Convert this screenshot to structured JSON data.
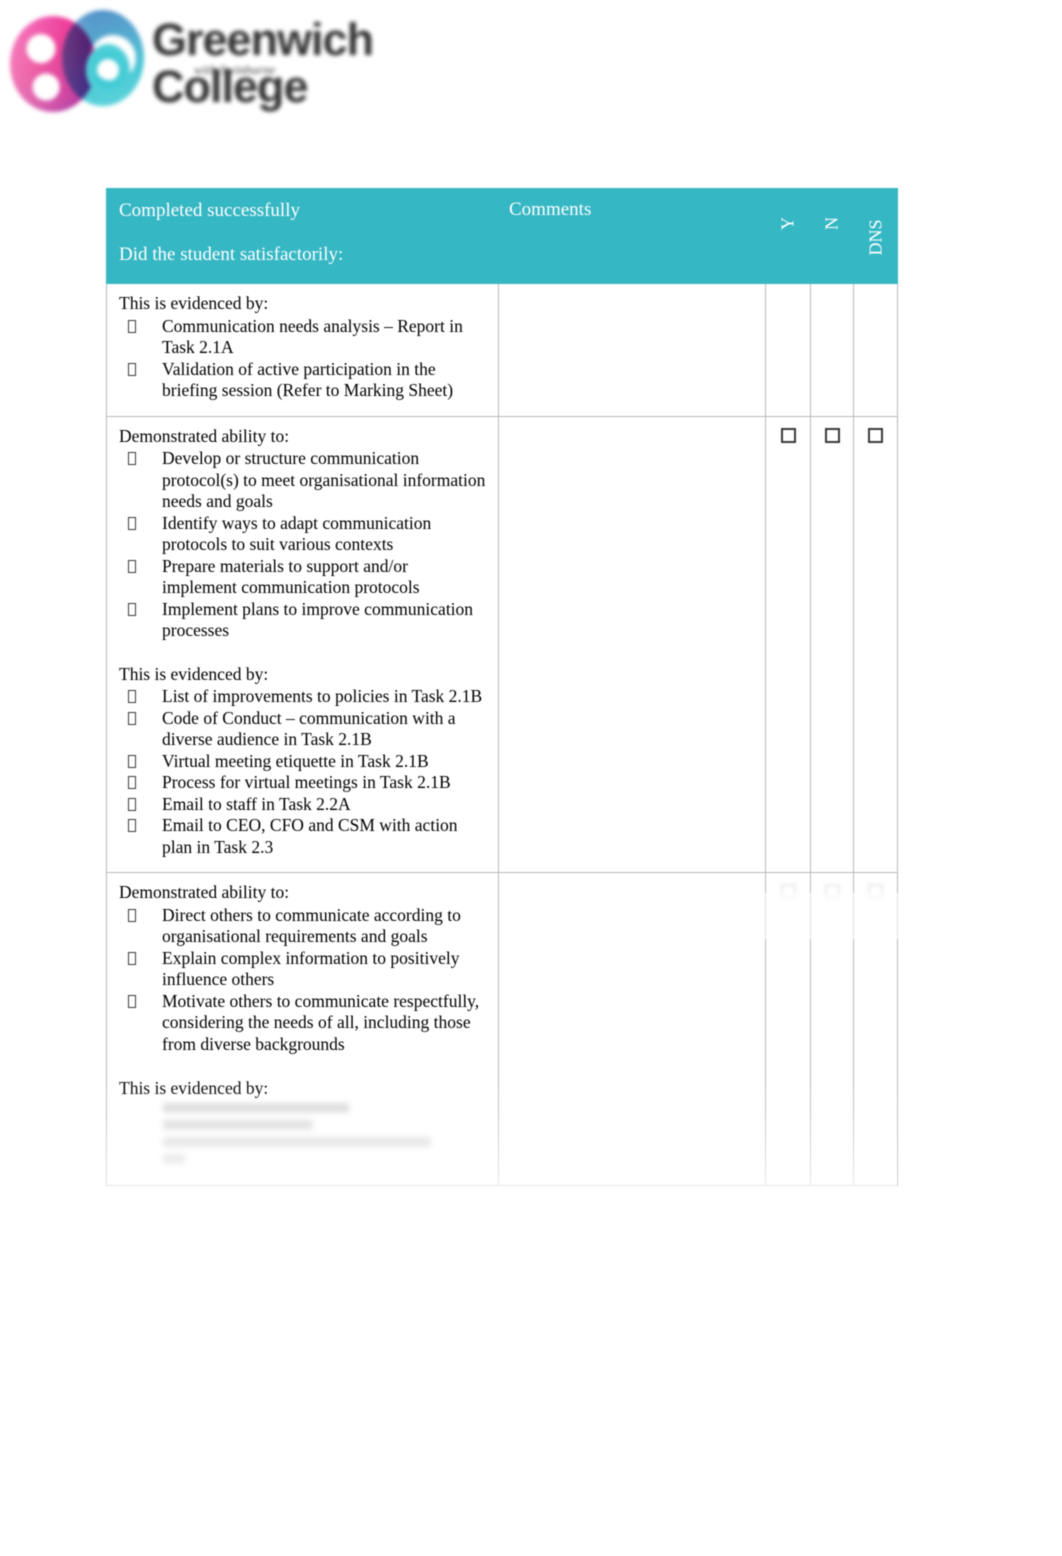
{
  "brand": {
    "logo_word_line1": "Greenwich",
    "logo_word_line2": "College",
    "logo_tagline": "with Swinburne",
    "accent_teal": "#36b7c4",
    "accent_pink": "#ef1d94",
    "link_teal": "#5fcede"
  },
  "table": {
    "header": {
      "col1_line1": "Completed successfully",
      "col1_line2": "Did the student satisfactorily:",
      "col2": "Comments",
      "col_y": "Y",
      "col_n": "N",
      "col_dns": "DNS"
    },
    "rows": [
      {
        "lead_1": "This is evidenced by:",
        "bullets_1": [
          "Communication needs analysis – Report in Task 2.1A",
          "Validation of active participation in the briefing session (Refer to Marking Sheet)"
        ],
        "comments": "",
        "y": "",
        "n": "",
        "dns": "",
        "checkboxes_visible": false
      },
      {
        "lead_1": "Demonstrated ability to:",
        "bullets_1": [
          "Develop or structure communication protocol(s) to meet organisational information needs and goals",
          "Identify ways to adapt communication protocols to suit various contexts",
          "Prepare materials to support and/or implement communication protocols",
          "Implement plans to improve communication processes"
        ],
        "lead_2": "This is evidenced by:",
        "bullets_2": [
          "List of improvements to policies in Task 2.1B",
          "Code of Conduct – communication with a diverse audience in Task 2.1B",
          "Virtual meeting etiquette in Task 2.1B",
          "Process for virtual meetings in Task 2.1B",
          "Email to staff in Task 2.2A",
          "Email to CEO, CFO and CSM with action plan in Task 2.3"
        ],
        "comments": "",
        "y": "",
        "n": "",
        "dns": "",
        "checkboxes_visible": true
      },
      {
        "lead_1": "Demonstrated ability to:",
        "bullets_1": [
          "Direct others to communicate according to organisational requirements and goals",
          "Explain complex information to positively influence others",
          "Motivate others to communicate respectfully, considering the needs of all, including those from diverse backgrounds"
        ],
        "lead_2": "This is evidenced by:",
        "bullets_2": [],
        "comments": "",
        "y": "",
        "n": "",
        "dns": "",
        "checkboxes_visible": true
      }
    ]
  },
  "footer": {
    "left_text": "",
    "page_number": "",
    "website": "",
    "rto": ""
  }
}
